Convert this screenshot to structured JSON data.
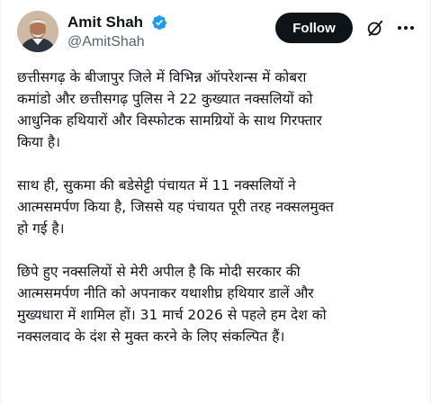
{
  "author": {
    "display_name": "Amit Shah",
    "handle": "@AmitShah",
    "verified": true,
    "avatar_icon": "profile-avatar",
    "verified_icon": "verified-badge-icon",
    "verified_color": "#1d9bf0"
  },
  "actions": {
    "follow_label": "Follow",
    "grok_icon": "grok-icon",
    "more_icon": "more-options-icon"
  },
  "tweet": {
    "paragraphs": [
      {
        "lines": [
          "छत्तीसगढ़ के बीजापुर जिले में विभिन्न ऑपरेशन्स में कोबरा",
          "कमांडो और छत्तीसगढ़ पुलिस ने 22 कुख्यात नक्सलियों को",
          "आधुनिक हथियारों और विस्फोटक सामग्रियों के साथ गिरफ्तार",
          "किया है।"
        ]
      },
      {
        "lines": [
          "साथ ही, सुकमा की बडेसेट्टी पंचायत में 11 नक्सलियों ने",
          "आत्मसमर्पण किया है, जिससे यह पंचायत पूरी तरह नक्सलमुक्त",
          "हो गई है।"
        ]
      },
      {
        "lines": [
          "छिपे हुए नक्सलियों से मेरी अपील है कि मोदी सरकार की",
          "आत्मसमर्पण नीति को अपनाकर यथाशीघ्र हथियार डालें और",
          "मुख्यधारा में शामिल हों। 31 मार्च 2026 से पहले हम देश को",
          "नक्सलवाद के दंश से मुक्त करने के लिए संकल्पित हैं।"
        ]
      }
    ]
  }
}
